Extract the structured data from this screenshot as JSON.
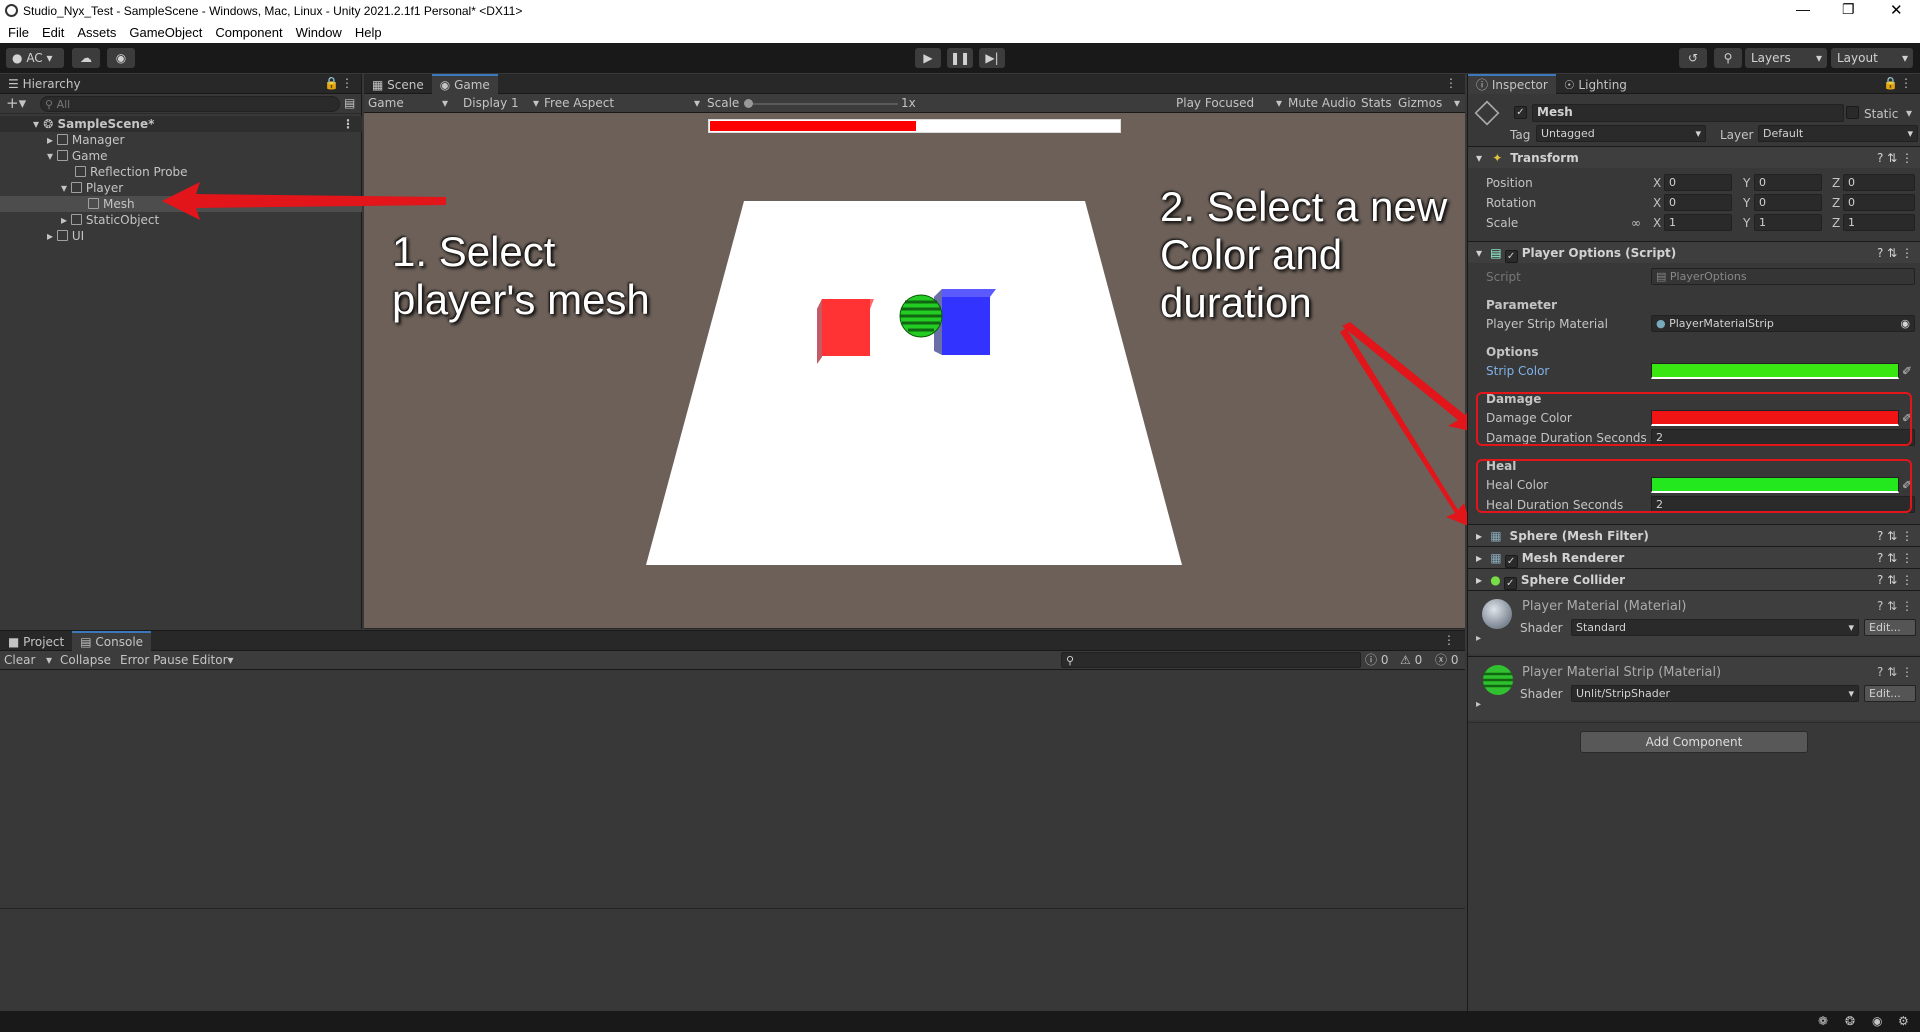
{
  "window": {
    "title": "Studio_Nyx_Test - SampleScene - Windows, Mac, Linux - Unity 2021.2.1f1 Personal* <DX11>"
  },
  "menu": [
    "File",
    "Edit",
    "Assets",
    "GameObject",
    "Component",
    "Window",
    "Help"
  ],
  "toolbar": {
    "account": "AC",
    "layers": "Layers",
    "layout": "Layout"
  },
  "hierarchy": {
    "tab": "Hierarchy",
    "search_placeholder": "All",
    "items": [
      {
        "label": "SampleScene*"
      },
      {
        "label": "Manager"
      },
      {
        "label": "Game"
      },
      {
        "label": "Reflection Probe"
      },
      {
        "label": "Player"
      },
      {
        "label": "Mesh"
      },
      {
        "label": "StaticObject"
      },
      {
        "label": "UI"
      }
    ]
  },
  "scene": {
    "tabs": [
      "Scene",
      "Game"
    ],
    "game_dropdown": "Game",
    "display": "Display 1",
    "aspect": "Free Aspect",
    "scale_label": "Scale",
    "scale_value": "1x",
    "play_focused": "Play Focused",
    "mute_audio": "Mute Audio",
    "stats": "Stats",
    "gizmos": "Gizmos",
    "health_fraction": 0.5
  },
  "annotations": {
    "step1": "1. Select player's mesh",
    "step2": "2. Select a new Color and duration"
  },
  "console": {
    "tabs": [
      "Project",
      "Console"
    ],
    "clear": "Clear",
    "collapse": "Collapse",
    "error_pause": "Error Pause",
    "editor": "Editor",
    "counts": [
      "0",
      "0",
      "0"
    ]
  },
  "inspector": {
    "tabs": [
      "Inspector",
      "Lighting"
    ],
    "object_name": "Mesh",
    "static_label": "Static",
    "tag_label": "Tag",
    "tag_value": "Untagged",
    "layer_label": "Layer",
    "layer_value": "Default",
    "transform": {
      "title": "Transform",
      "position_label": "Position",
      "rotation_label": "Rotation",
      "scale_label": "Scale",
      "position": [
        "0",
        "0",
        "0"
      ],
      "rotation": [
        "0",
        "0",
        "0"
      ],
      "scale": [
        "1",
        "1",
        "1"
      ]
    },
    "player_options": {
      "title": "Player Options (Script)",
      "script_label": "Script",
      "script_value": "PlayerOptions",
      "parameter_header": "Parameter",
      "strip_material_label": "Player Strip Material",
      "strip_material_value": "PlayerMaterialStrip",
      "options_header": "Options",
      "strip_color_label": "Strip Color",
      "strip_color": "#39e612",
      "damage_header": "Damage",
      "damage_color_label": "Damage Color",
      "damage_color": "#f01414",
      "damage_duration_label": "Damage Duration Seconds",
      "damage_duration": "2",
      "heal_header": "Heal",
      "heal_color_label": "Heal Color",
      "heal_color": "#22e81d",
      "heal_duration_label": "Heal Duration Seconds",
      "heal_duration": "2"
    },
    "components": [
      "Sphere (Mesh Filter)",
      "Mesh Renderer",
      "Sphere Collider"
    ],
    "materials": [
      {
        "title": "Player Material (Material)",
        "shader_label": "Shader",
        "shader": "Standard",
        "edit": "Edit..."
      },
      {
        "title": "Player Material Strip (Material)",
        "shader_label": "Shader",
        "shader": "Unlit/StripShader",
        "edit": "Edit..."
      }
    ],
    "add_component": "Add Component"
  },
  "colors": {
    "accent": "#3a79bb",
    "annotation_red": "#e1151a"
  }
}
